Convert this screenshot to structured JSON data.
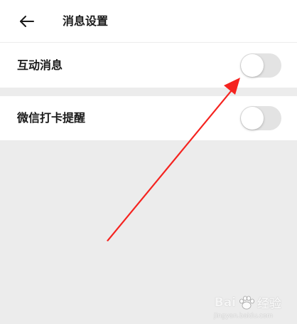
{
  "header": {
    "title": "消息设置",
    "back_icon": "arrow-left-icon"
  },
  "settings": [
    {
      "label": "互动消息",
      "enabled": false
    },
    {
      "label": "微信打卡提醒",
      "enabled": false
    }
  ],
  "annotation": {
    "arrow_color": "#f5231f",
    "arrow_icon": "red-arrow-annotation"
  },
  "watermark": {
    "text_left": "Bai",
    "text_right": "经验",
    "url": "jingyan.baidu.com"
  },
  "colors": {
    "toggle_off": "#e3e3e3",
    "section_gap": "#ececec",
    "accent": "#f5231f"
  }
}
